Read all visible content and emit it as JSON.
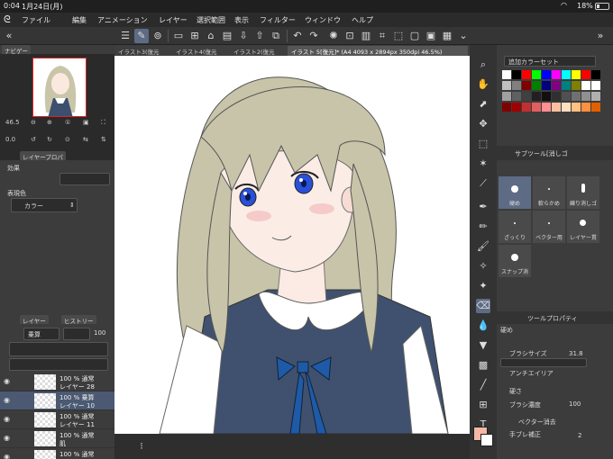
{
  "status": {
    "time": "0:04",
    "date": "1月24日(月)",
    "battery": "18%",
    "battery_level": 0.18
  },
  "menu": [
    "ファイル",
    "編集",
    "アニメーション",
    "レイヤー",
    "選択範囲",
    "表示",
    "フィルター",
    "ウィンドウ",
    "ヘルプ"
  ],
  "tabs": [
    "イラスト3(復元",
    "イラスト4(復元",
    "イラスト2(復元",
    "イラスト 5[復元]* (A4 4093 x 2894px 350dpi 46.5%)"
  ],
  "navigator": {
    "tab_label": "ナビゲー",
    "zoom": "46.5",
    "rotation": "0.0"
  },
  "layer_property": {
    "tab_label": "レイヤープロパ",
    "effect_label": "効果",
    "expression_color_label": "表現色",
    "color_value": "カラー"
  },
  "layer_panel": {
    "tab_label": "レイヤー",
    "history_tab_label": "ヒストリー",
    "blend_mode": "乗算",
    "opacity": "100",
    "layers": [
      {
        "line1": "100 % 通常",
        "line2": "レイヤー 28"
      },
      {
        "line1": "100 % 乗算",
        "line2": "レイヤー 10"
      },
      {
        "line1": "100 % 通常",
        "line2": "レイヤー 11"
      },
      {
        "line1": "100 % 通常",
        "line2": "肌"
      },
      {
        "line1": "100 % 通常",
        "line2": ""
      }
    ]
  },
  "color_set": {
    "label": "追加カラーセット",
    "colors": [
      "#ffffff",
      "#000000",
      "#ff0000",
      "#00ff00",
      "#0000ff",
      "#ff00ff",
      "#00ffff",
      "#ffff00",
      "#ff0000",
      "#000000",
      "#c0c0c0",
      "#808080",
      "#800000",
      "#008000",
      "#000080",
      "#800080",
      "#008080",
      "#808000",
      "#ffffff",
      "#ffffff",
      "#a0a0a0",
      "#606060",
      "#404040",
      "#202020",
      "#101010",
      "#303030",
      "#505050",
      "#707070",
      "#909090",
      "#b0b0b0",
      "#800000",
      "#a00000",
      "#c03030",
      "#e06060",
      "#ff9090",
      "#ffc0a0",
      "#ffe0c0",
      "#ffc080",
      "#ff9040",
      "#e06000"
    ]
  },
  "subtool": {
    "header": "サブツール[消しゴ",
    "items": [
      "硬め",
      "軟らかめ",
      "練り消しゴ",
      "ざっくり",
      "ベクター用",
      "レイヤー貫",
      "スナップ消"
    ]
  },
  "tool_property": {
    "header": "ツールプロパティ",
    "brush_name": "硬め",
    "brush_size_label": "ブラシサイズ",
    "brush_size": "31.8",
    "antialias_label": "アンチエイリア",
    "hardness_label": "硬さ",
    "brush_density_label": "ブラシ濃度",
    "brush_density": "100",
    "vector_erase_label": "ベクター消去",
    "stabilization_label": "手ブレ補正",
    "stabilization": "2"
  },
  "main_color": "#f6b7a4",
  "sub_color": "#ffffff"
}
